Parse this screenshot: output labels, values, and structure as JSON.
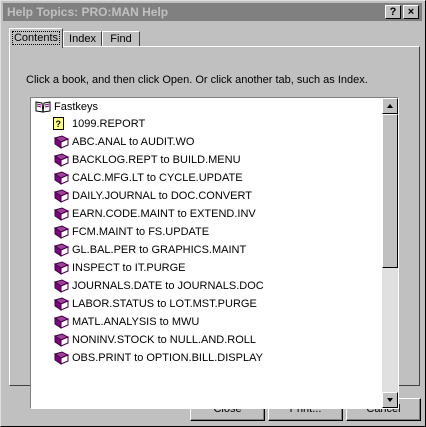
{
  "window": {
    "title": "Help Topics: PRO:MAN Help",
    "help_button": "?",
    "close_button": "×"
  },
  "tabs": [
    {
      "label": "Contents",
      "active": true
    },
    {
      "label": "Index",
      "active": false
    },
    {
      "label": "Find",
      "active": false
    }
  ],
  "instructions": "Click a book, and then click Open. Or click another tab, such as Index.",
  "tree": {
    "root": {
      "label": "Fastkeys",
      "icon": "open-book-icon"
    },
    "items": [
      {
        "label": "1099.REPORT",
        "icon": "help-page-icon"
      },
      {
        "label": "ABC.ANAL to AUDIT.WO",
        "icon": "book-icon"
      },
      {
        "label": "BACKLOG.REPT to BUILD.MENU",
        "icon": "book-icon"
      },
      {
        "label": "CALC.MFG.LT to CYCLE.UPDATE",
        "icon": "book-icon"
      },
      {
        "label": "DAILY.JOURNAL to DOC.CONVERT",
        "icon": "book-icon"
      },
      {
        "label": "EARN.CODE.MAINT to EXTEND.INV",
        "icon": "book-icon"
      },
      {
        "label": "FCM.MAINT to FS.UPDATE",
        "icon": "book-icon"
      },
      {
        "label": "GL.BAL.PER to GRAPHICS.MAINT",
        "icon": "book-icon"
      },
      {
        "label": "INSPECT to IT.PURGE",
        "icon": "book-icon"
      },
      {
        "label": "JOURNALS.DATE to JOURNALS.DOC",
        "icon": "book-icon"
      },
      {
        "label": "LABOR.STATUS to LOT.MST.PURGE",
        "icon": "book-icon"
      },
      {
        "label": "MATL.ANALYSIS to MWU",
        "icon": "book-icon"
      },
      {
        "label": "NONINV.STOCK to NULL.AND.ROLL",
        "icon": "book-icon"
      },
      {
        "label": "OBS.PRINT to OPTION.BILL.DISPLAY",
        "icon": "book-icon"
      }
    ]
  },
  "buttons": {
    "close": "Close",
    "print": "Print...",
    "cancel": "Cancel"
  },
  "colors": {
    "titlebar": "#808080",
    "book": "#800080",
    "face": "#c0c0c0"
  }
}
